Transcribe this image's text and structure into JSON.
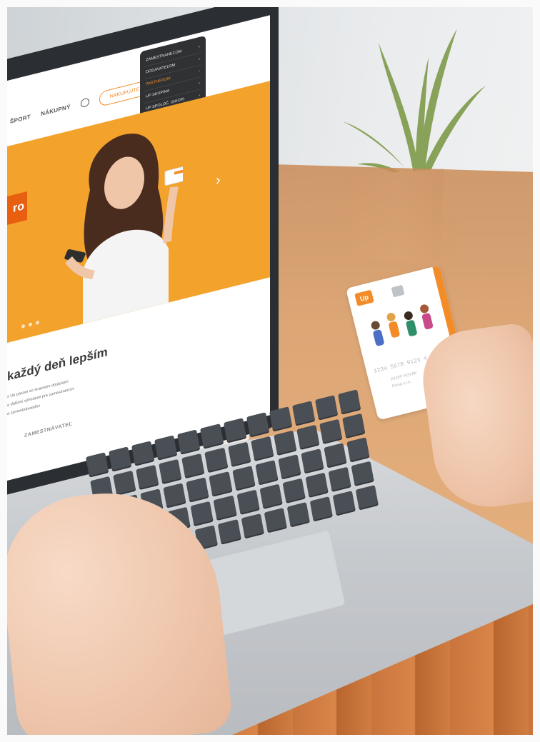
{
  "photo": {
    "subject": "laptop-with-up-website-and-card"
  },
  "website": {
    "nav": {
      "links": [
        "ŠPORT",
        "NÁKUPNÝ"
      ],
      "cta_label": "NAKUPUJTE"
    },
    "dropdown": {
      "items": [
        {
          "label": "ZAMESTNANECOM",
          "active": false
        },
        {
          "label": "DODÁVATEĽOM",
          "active": false
        },
        {
          "label": "PARTNEROM",
          "active": true
        },
        {
          "label": "UP SKUPINA",
          "active": false
        },
        {
          "label": "UP SPOLOČ. (SHOP)",
          "active": false
        }
      ]
    },
    "hero": {
      "tag_text": "ro",
      "accent_color": "#f3a22c"
    },
    "headline": "každý deň lepším",
    "body_lines": [
      "s Up pasom so stravným dotáciami",
      "a ďalšími výhodami pre zamestnancov",
      "a zamestnávateľov"
    ],
    "employer_label": "ZAMESTNÁVATEĽ"
  },
  "card": {
    "logo_text": "Up",
    "number": "1234 5678 9123 4",
    "holder_lines": [
      "JOZEF NOVÁK",
      "Firma s.r.o."
    ],
    "accent_color": "#f28c28"
  }
}
